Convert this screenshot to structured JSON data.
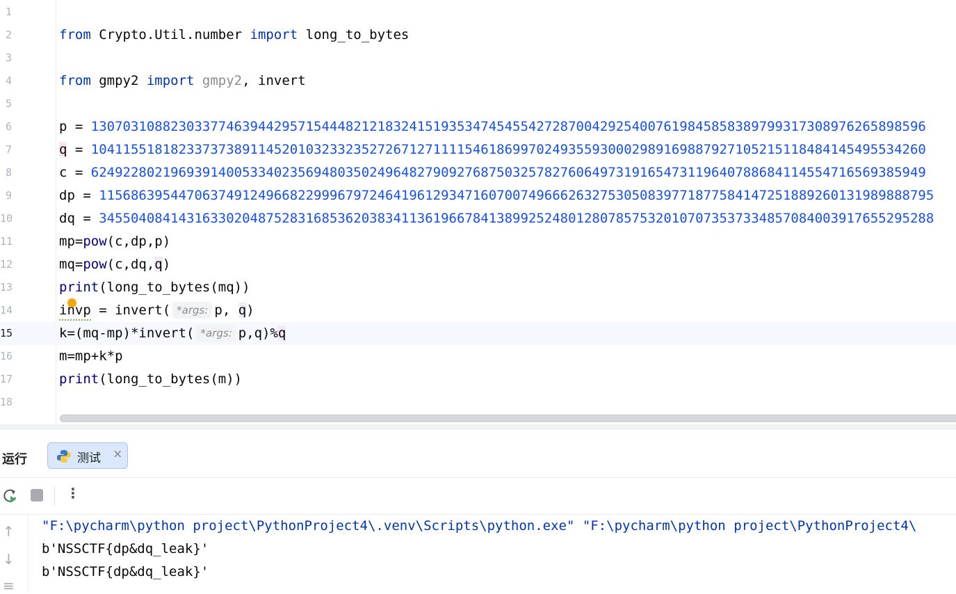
{
  "editor": {
    "line_numbers": [
      "1",
      "2",
      "3",
      "4",
      "5",
      "6",
      "7",
      "8",
      "9",
      "10",
      "11",
      "12",
      "13",
      "14",
      "15",
      "16",
      "17",
      "18"
    ],
    "current_line": "15",
    "line2": {
      "kw_from": "from",
      "module": " Crypto.Util.number ",
      "kw_import": "import",
      "name": " long_to_bytes"
    },
    "line4": {
      "kw_from": "from",
      "module": " gmpy2 ",
      "kw_import": "import",
      "dim": " gmpy2",
      "rest": ", invert"
    },
    "line6": {
      "lhs": "p = ",
      "value": "130703108823033774639442957154448212183241519353474545542728700429254007619845858389799317308976265898596"
    },
    "line7": {
      "lhs": "q",
      "mid": " = ",
      "value": "104115518182337373891145201032332352726712711115461869970249355930002989169887927105215118484145495534260"
    },
    "line8": {
      "lhs": "c = ",
      "value": "624922802196939140053340235694803502496482790927687503257827606497319165473119640788684114554716569385949"
    },
    "line9": {
      "lhs": "dp = ",
      "value": "115686395447063749124966822999679724641961293471607007496662632753050839771877584147251889260131989888795"
    },
    "line10": {
      "lhs": "dq = ",
      "value": "345504084143163302048752831685362038341136196678413899252480128078575320107073537334857084003917655295288"
    },
    "line11": {
      "a": "mp=",
      "fn": "pow",
      "b": "(c,dp,p)"
    },
    "line12": {
      "a": "mq=",
      "fn": "pow",
      "b": "(c,dq,",
      "q": "q",
      "c": ")"
    },
    "line13": {
      "fn": "print",
      "b": "(long_to_bytes(mq))"
    },
    "line14": {
      "a": "invp = invert(",
      "hint": "*args:",
      "b": "p, ",
      "q": "q",
      "c": ")"
    },
    "line15": {
      "a": "k=(mq-mp)*invert(",
      "hint": "*args:",
      "b": "p,q)%",
      "q": "q"
    },
    "line16": {
      "a": "m=mp+k*p"
    },
    "line17": {
      "fn": "print",
      "b": "(long_to_bytes(m))"
    }
  },
  "run_panel": {
    "title": "运行",
    "tab_label": "测试",
    "tab_close": "×",
    "more": "⋮",
    "output": [
      "\"F:\\pycharm\\python project\\PythonProject4\\.venv\\Scripts\\python.exe\" \"F:\\pycharm\\python project\\PythonProject4\\",
      "b'NSSCTF{dp&dq_leak}'",
      "b'NSSCTF{dp&dq_leak}'"
    ],
    "side_icons": [
      "↑",
      "↓",
      "≡"
    ]
  },
  "colors": {
    "keyword": "#0033b3",
    "number": "#1750eb",
    "warning": "#f2a80d",
    "tab_bg": "#dbe8fb"
  }
}
